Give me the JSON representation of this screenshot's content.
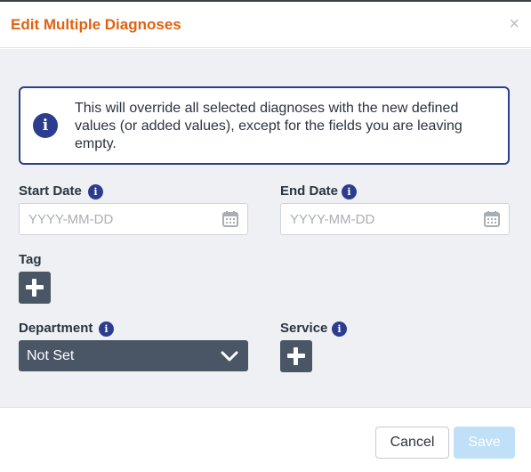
{
  "dialog": {
    "title": "Edit Multiple Diagnoses",
    "close_symbol": "×"
  },
  "info": {
    "icon": "info-icon",
    "text": "This will override all selected diagnoses with the new defined values (or added values), except for the fields you are leaving empty."
  },
  "fields": {
    "start_date": {
      "label": "Start Date",
      "value": "",
      "placeholder": "YYYY-MM-DD",
      "icon": "calendar-icon"
    },
    "end_date": {
      "label": "End Date",
      "value": "",
      "placeholder": "YYYY-MM-DD",
      "icon": "calendar-icon"
    },
    "tag": {
      "label": "Tag",
      "icon": "plus-icon"
    },
    "department": {
      "label": "Department",
      "selected": "Not Set",
      "icon": "chevron-down-icon"
    },
    "service": {
      "label": "Service",
      "icon": "plus-icon"
    }
  },
  "footer": {
    "cancel_label": "Cancel",
    "save_label": "Save"
  },
  "colors": {
    "title": "#e0620f",
    "accent": "#2c3d8f",
    "control_dark": "#4a5666",
    "save_disabled": "#bfe0f7"
  }
}
